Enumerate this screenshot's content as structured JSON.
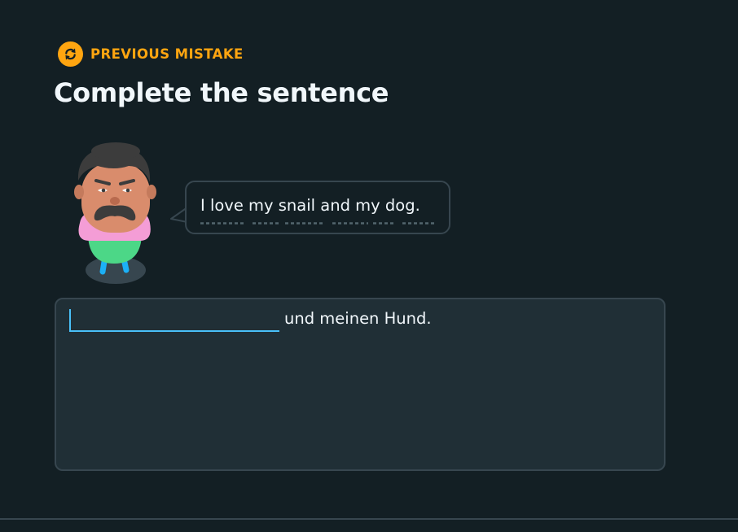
{
  "header": {
    "tag_label": "PREVIOUS MISTAKE",
    "tag_icon": "refresh-arrows-icon",
    "title": "Complete the sentence"
  },
  "prompt": {
    "character": "mustache-character-avatar",
    "speech_text": "I love my snail and my dog."
  },
  "answer": {
    "blank_value": "",
    "blank_placeholder": "",
    "sentence_rest": "und meinen Hund."
  },
  "colors": {
    "background": "#131f24",
    "accent_orange": "#ffa510",
    "border": "#37464f",
    "input_focus": "#49c0f8",
    "answer_box_bg": "#202f36"
  }
}
